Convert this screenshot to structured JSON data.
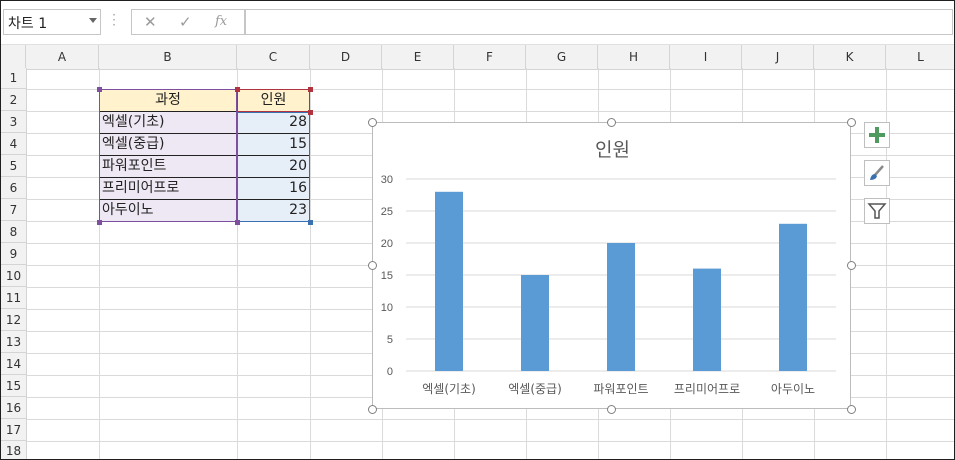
{
  "formula_bar": {
    "name_box": "차트 1",
    "cancel_icon": "✕",
    "enter_icon": "✓",
    "fx_icon": "fx",
    "formula": ""
  },
  "columns": [
    "A",
    "B",
    "C",
    "D",
    "E",
    "F",
    "G",
    "H",
    "I",
    "J",
    "K",
    "L"
  ],
  "rows": [
    "1",
    "2",
    "3",
    "4",
    "5",
    "6",
    "7",
    "8",
    "9",
    "10",
    "11",
    "12",
    "13",
    "14",
    "15",
    "16",
    "17",
    "18"
  ],
  "table": {
    "header_category": "과정",
    "header_value": "인원",
    "rows": [
      {
        "category": "엑셀(기초)",
        "value": "28"
      },
      {
        "category": "엑셀(중급)",
        "value": "15"
      },
      {
        "category": "파워포인트",
        "value": "20"
      },
      {
        "category": "프리미어프로",
        "value": "16"
      },
      {
        "category": "아두이노",
        "value": "23"
      }
    ]
  },
  "chart_data": {
    "type": "bar",
    "title": "인원",
    "categories": [
      "엑셀(기초)",
      "엑셀(중급)",
      "파워포인트",
      "프리미어프로",
      "아두이노"
    ],
    "values": [
      28,
      15,
      20,
      16,
      23
    ],
    "ylim": [
      0,
      30
    ],
    "yticks": [
      0,
      5,
      10,
      15,
      20,
      25,
      30
    ],
    "grid": true,
    "bar_color": "#5b9bd5"
  },
  "chart_tools": {
    "elements_icon": "plus-icon",
    "styles_icon": "brush-icon",
    "filters_icon": "funnel-icon"
  }
}
